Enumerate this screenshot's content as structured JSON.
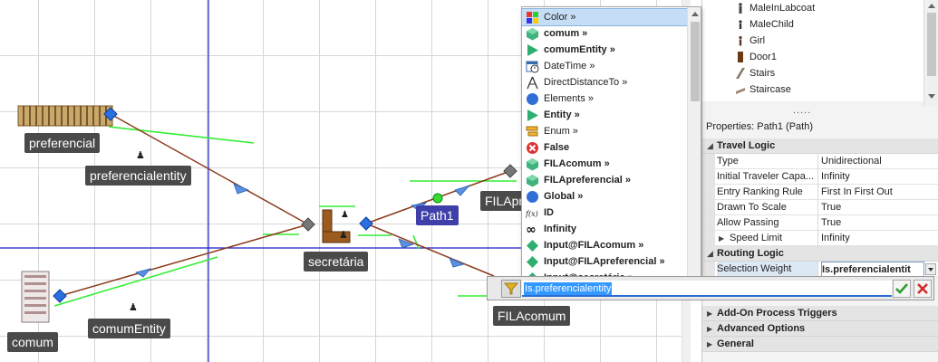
{
  "canvas": {
    "labels": {
      "preferencial": "preferencial",
      "preferencialentity": "preferencialentity",
      "secretaria": "secretária",
      "path1": "Path1",
      "filapref": "FILAprefer",
      "filacomum": "FILAcomum",
      "comumentity": "comumEntity",
      "comum": "comum"
    }
  },
  "library": {
    "items": [
      "MaleInLabcoat",
      "MaleChild",
      "Girl",
      "Door1",
      "Stairs",
      "Staircase"
    ]
  },
  "properties": {
    "header": "Properties: Path1 (Path)",
    "divider": ".....",
    "categories": {
      "travel_logic": "Travel Logic",
      "routing_logic": "Routing Logic",
      "addon": "Add-On Process Triggers",
      "advanced": "Advanced Options",
      "general": "General"
    },
    "rows": [
      {
        "name": "Type",
        "value": "Unidirectional"
      },
      {
        "name": "Initial Traveler Capa...",
        "value": "Infinity"
      },
      {
        "name": "Entry Ranking Rule",
        "value": "First In First Out"
      },
      {
        "name": "Drawn To Scale",
        "value": "True"
      },
      {
        "name": "Allow Passing",
        "value": "True"
      },
      {
        "name": "Speed Limit",
        "value": "Infinity"
      }
    ],
    "selection_weight": {
      "name": "Selection Weight",
      "value": "Is.preferencialentit"
    }
  },
  "dropdown": {
    "items": [
      {
        "label": "Color »",
        "icon": "color-palette-icon",
        "bold": false
      },
      {
        "label": "comum »",
        "icon": "cube-icon",
        "bold": true
      },
      {
        "label": "comumEntity »",
        "icon": "triangle-entity-icon",
        "bold": true
      },
      {
        "label": "DateTime »",
        "icon": "datetime-icon",
        "bold": false
      },
      {
        "label": "DirectDistanceTo »",
        "icon": "distance-icon",
        "bold": false
      },
      {
        "label": "Elements »",
        "icon": "elements-circle-icon",
        "bold": false
      },
      {
        "label": "Entity »",
        "icon": "triangle-entity-icon",
        "bold": true
      },
      {
        "label": "Enum »",
        "icon": "enum-icon",
        "bold": false
      },
      {
        "label": "False",
        "icon": "false-icon",
        "bold": true
      },
      {
        "label": "FILAcomum »",
        "icon": "cube-icon",
        "bold": true
      },
      {
        "label": "FILApreferencial »",
        "icon": "cube-icon",
        "bold": true
      },
      {
        "label": "Global »",
        "icon": "global-circle-icon",
        "bold": true
      },
      {
        "label": "ID",
        "icon": "function-icon",
        "bold": true
      },
      {
        "label": "Infinity",
        "icon": "infinity-icon",
        "bold": true
      },
      {
        "label": "Input@FILAcomum »",
        "icon": "diamond-icon",
        "bold": true
      },
      {
        "label": "Input@FILApreferencial »",
        "icon": "diamond-icon",
        "bold": true
      },
      {
        "label": "Input@secretária »",
        "icon": "diamond-icon",
        "bold": true
      }
    ]
  },
  "expression": {
    "value": "Is.preferencialentity"
  },
  "colors": {
    "path_line": "#8b3a1a",
    "green_line": "#33ee33",
    "node_blue": "#2a6fe0",
    "grid_blue": "#1c1cc8",
    "label_bg": "#4a4a4a",
    "selected_label_bg": "#3f3faa"
  }
}
